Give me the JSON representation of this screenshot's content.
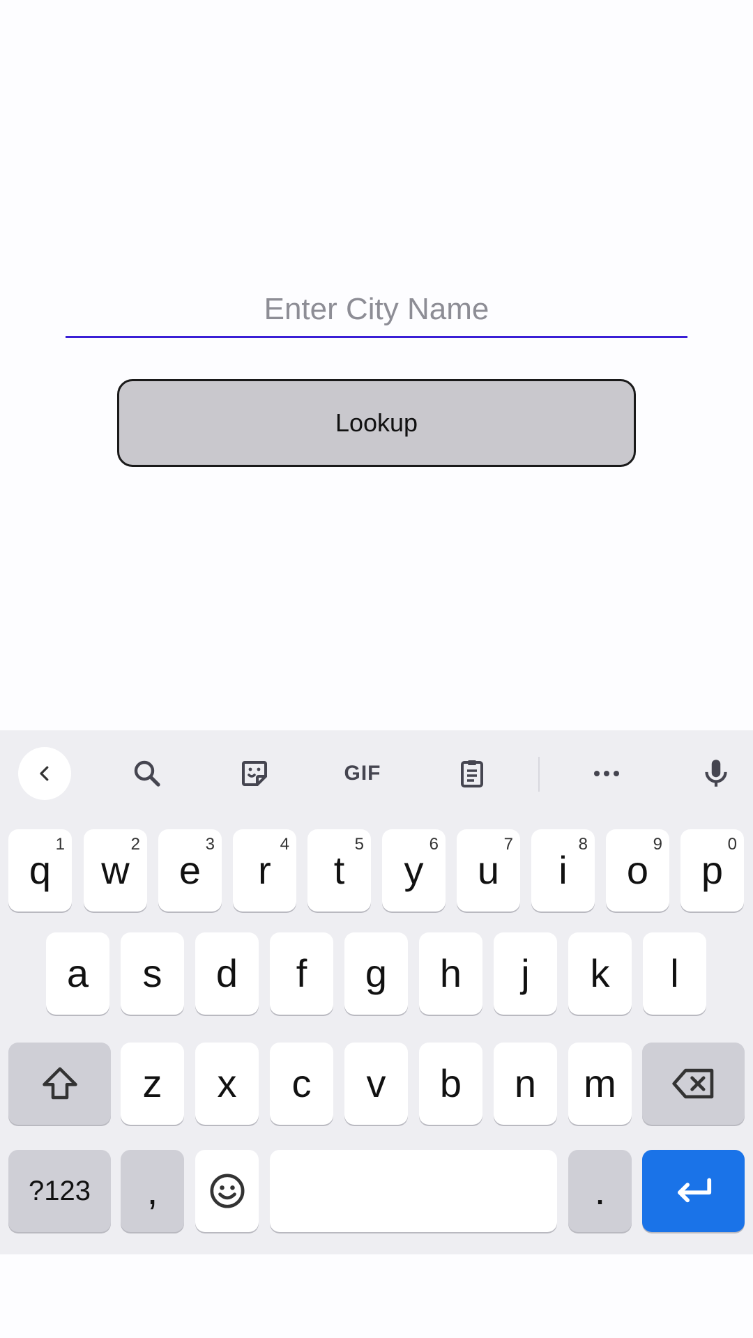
{
  "form": {
    "city_placeholder": "Enter City Name",
    "city_value": "",
    "lookup_label": "Lookup"
  },
  "keyboard": {
    "toolbar": {
      "gif_label": "GIF",
      "icons": [
        "chevron-left-icon",
        "search-icon",
        "sticker-icon",
        "gif-icon",
        "clipboard-icon",
        "more-icon",
        "mic-icon"
      ]
    },
    "row1": [
      {
        "key": "q",
        "hint": "1"
      },
      {
        "key": "w",
        "hint": "2"
      },
      {
        "key": "e",
        "hint": "3"
      },
      {
        "key": "r",
        "hint": "4"
      },
      {
        "key": "t",
        "hint": "5"
      },
      {
        "key": "y",
        "hint": "6"
      },
      {
        "key": "u",
        "hint": "7"
      },
      {
        "key": "i",
        "hint": "8"
      },
      {
        "key": "o",
        "hint": "9"
      },
      {
        "key": "p",
        "hint": "0"
      }
    ],
    "row2": [
      "a",
      "s",
      "d",
      "f",
      "g",
      "h",
      "j",
      "k",
      "l"
    ],
    "row3": [
      "z",
      "x",
      "c",
      "v",
      "b",
      "n",
      "m"
    ],
    "symbols_label": "?123",
    "comma_label": ",",
    "period_label": ".",
    "colors": {
      "accent": "#3a1fd6",
      "enter_key": "#1a73e8",
      "keyboard_bg": "#eeeef2",
      "key_bg": "#ffffff",
      "modifier_key_bg": "#cfcfd6"
    }
  }
}
